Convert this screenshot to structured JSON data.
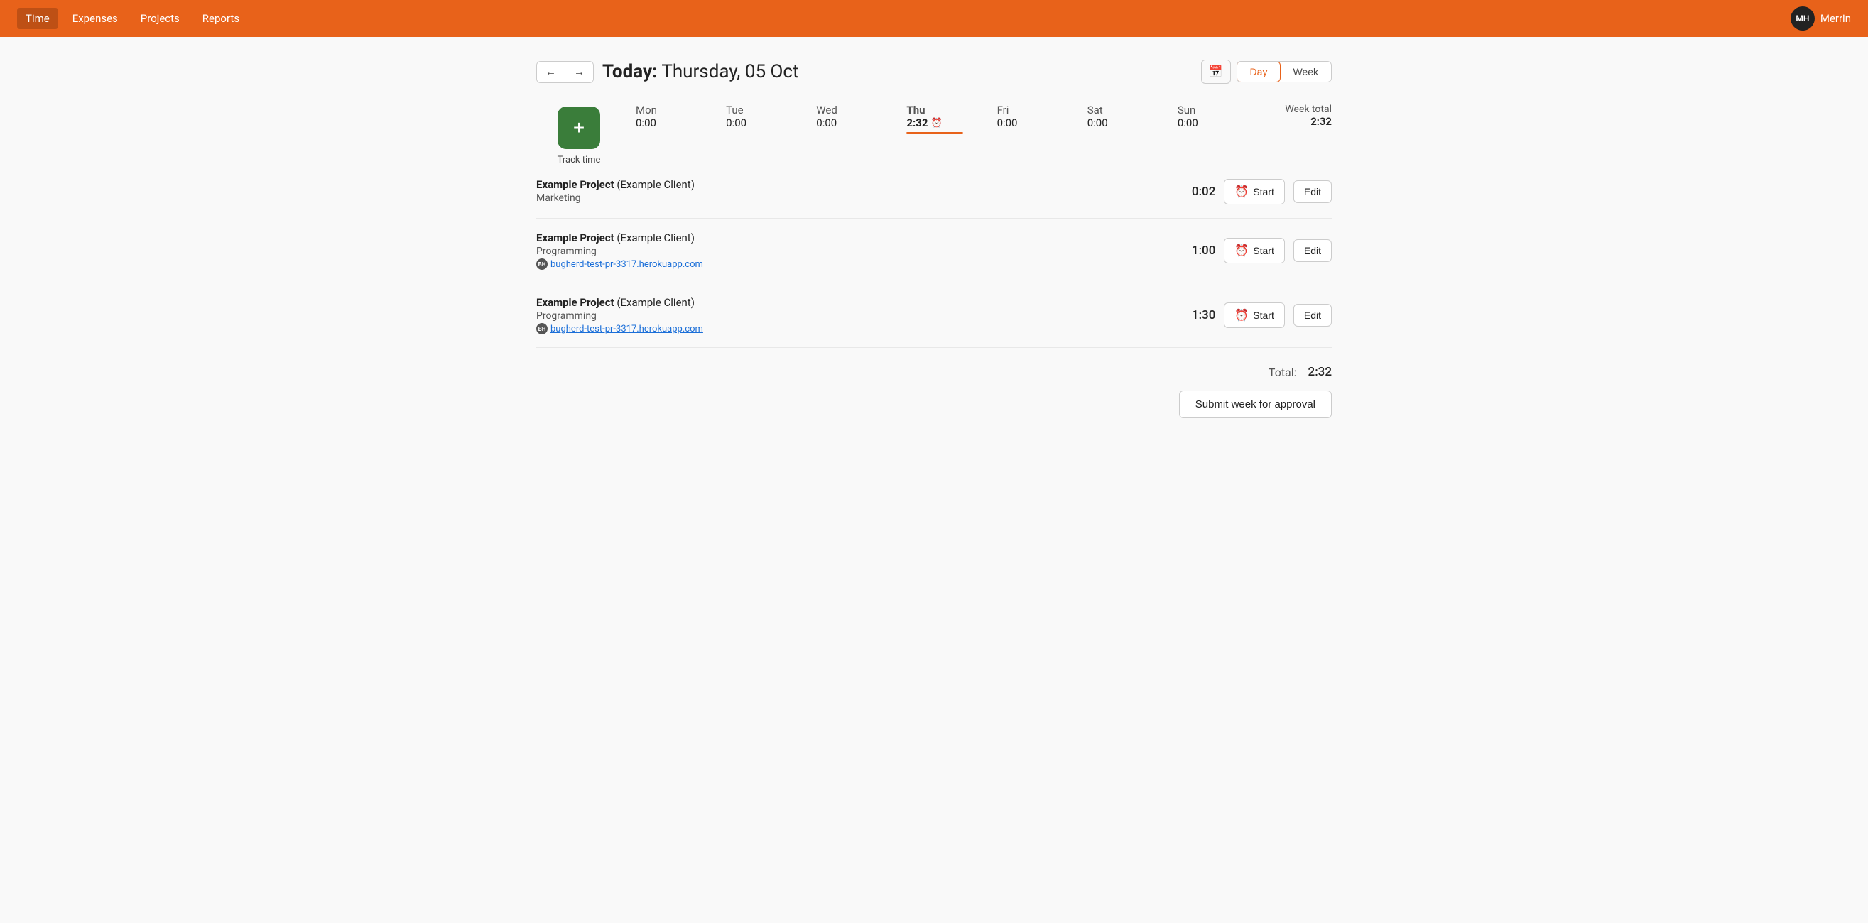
{
  "navbar": {
    "items": [
      {
        "id": "time",
        "label": "Time",
        "active": true
      },
      {
        "id": "expenses",
        "label": "Expenses",
        "active": false
      },
      {
        "id": "projects",
        "label": "Projects",
        "active": false
      },
      {
        "id": "reports",
        "label": "Reports",
        "active": false
      }
    ],
    "user": {
      "initials": "MH",
      "name": "Merrin"
    }
  },
  "header": {
    "today_prefix": "Today:",
    "date": "Thursday, 05 Oct",
    "prev_arrow": "←",
    "next_arrow": "→",
    "calendar_icon": "📅",
    "view_day": "Day",
    "view_week": "Week"
  },
  "week": {
    "days": [
      {
        "id": "mon",
        "name": "Mon",
        "hours": "0:00",
        "active": false
      },
      {
        "id": "tue",
        "name": "Tue",
        "hours": "0:00",
        "active": false
      },
      {
        "id": "wed",
        "name": "Wed",
        "hours": "0:00",
        "active": false
      },
      {
        "id": "thu",
        "name": "Thu",
        "hours": "2:32",
        "active": true
      },
      {
        "id": "fri",
        "name": "Fri",
        "hours": "0:00",
        "active": false
      },
      {
        "id": "sat",
        "name": "Sat",
        "hours": "0:00",
        "active": false
      },
      {
        "id": "sun",
        "name": "Sun",
        "hours": "0:00",
        "active": false
      }
    ],
    "total_label": "Week total",
    "total_hours": "2:32"
  },
  "track_time": {
    "add_icon": "+",
    "label": "Track time"
  },
  "entries": [
    {
      "id": "entry-1",
      "project_bold": "Example Project",
      "project_rest": " (Example Client)",
      "category": "Marketing",
      "has_link": false,
      "link": "",
      "duration": "0:02",
      "start_label": "Start",
      "edit_label": "Edit"
    },
    {
      "id": "entry-2",
      "project_bold": "Example Project",
      "project_rest": " (Example Client)",
      "category": "Programming",
      "has_link": true,
      "link": "bugherd-test-pr-3317.herokuapp.com",
      "duration": "1:00",
      "start_label": "Start",
      "edit_label": "Edit"
    },
    {
      "id": "entry-3",
      "project_bold": "Example Project",
      "project_rest": " (Example Client)",
      "category": "Programming",
      "has_link": true,
      "link": "bugherd-test-pr-3317.herokuapp.com",
      "duration": "1:30",
      "start_label": "Start",
      "edit_label": "Edit"
    }
  ],
  "total": {
    "label": "Total:",
    "value": "2:32"
  },
  "submit": {
    "label": "Submit week for approval"
  }
}
